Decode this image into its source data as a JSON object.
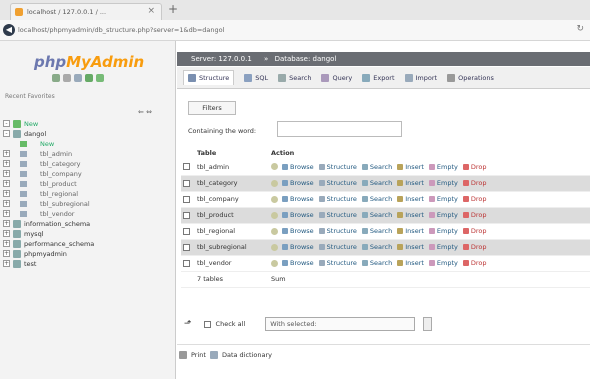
{
  "browser": {
    "tab_title": "localhost / 127.0.0.1 / ...",
    "tab_close": "×",
    "new_tab": "+",
    "url": "localhost/phpmyadmin/db_structure.php?server=1&db=dangol",
    "reload": "↻"
  },
  "nav": {
    "logo_php": "php",
    "logo_myadmin": "MyAdmin",
    "recent": "Recent  Favorites",
    "collapse": "⇐ ⇔",
    "tree": [
      {
        "level": 0,
        "expander": "-",
        "label": "New",
        "kind": "new"
      },
      {
        "level": 0,
        "expander": "-",
        "label": "dangol",
        "kind": "db"
      },
      {
        "level": 1,
        "expander": "",
        "label": "New",
        "kind": "new"
      },
      {
        "level": 1,
        "expander": "+",
        "label": "tbl_admin",
        "kind": "table"
      },
      {
        "level": 1,
        "expander": "+",
        "label": "tbl_category",
        "kind": "table"
      },
      {
        "level": 1,
        "expander": "+",
        "label": "tbl_company",
        "kind": "table"
      },
      {
        "level": 1,
        "expander": "+",
        "label": "tbl_product",
        "kind": "table"
      },
      {
        "level": 1,
        "expander": "+",
        "label": "tbl_regional",
        "kind": "table"
      },
      {
        "level": 1,
        "expander": "+",
        "label": "tbl_subregional",
        "kind": "table"
      },
      {
        "level": 1,
        "expander": "+",
        "label": "tbl_vendor",
        "kind": "table"
      },
      {
        "level": 0,
        "expander": "+",
        "label": "information_schema",
        "kind": "db"
      },
      {
        "level": 0,
        "expander": "+",
        "label": "mysql",
        "kind": "db"
      },
      {
        "level": 0,
        "expander": "+",
        "label": "performance_schema",
        "kind": "db"
      },
      {
        "level": 0,
        "expander": "+",
        "label": "phpmyadmin",
        "kind": "db"
      },
      {
        "level": 0,
        "expander": "+",
        "label": "test",
        "kind": "db"
      }
    ]
  },
  "main": {
    "breadcrumb": {
      "server": "Server: 127.0.0.1",
      "sep": "»",
      "database": "Database: dangol"
    },
    "tabs": [
      {
        "label": "Structure",
        "active": true,
        "color": "#7a8fb0"
      },
      {
        "label": "SQL",
        "active": false,
        "color": "#8aa0c0"
      },
      {
        "label": "Search",
        "active": false,
        "color": "#9aa"
      },
      {
        "label": "Query",
        "active": false,
        "color": "#a9b"
      },
      {
        "label": "Export",
        "active": false,
        "color": "#8ab"
      },
      {
        "label": "Import",
        "active": false,
        "color": "#9ab"
      },
      {
        "label": "Operations",
        "active": false,
        "color": "#999"
      }
    ],
    "filters_button": "Filters",
    "containing_label": "Containing the word:",
    "table_headers": [
      "",
      "Table",
      "Action"
    ],
    "actions": [
      "Browse",
      "Structure",
      "Search",
      "Insert",
      "Empty",
      "Drop"
    ],
    "tables": [
      "tbl_admin",
      "tbl_category",
      "tbl_company",
      "tbl_product",
      "tbl_regional",
      "tbl_subregional",
      "tbl_vendor"
    ],
    "summary": {
      "count": "7 tables",
      "sum": "Sum"
    },
    "check_all": "Check all",
    "with_selected": "With selected:",
    "footer_print": "Print",
    "footer_dictionary": "Data dictionary"
  }
}
